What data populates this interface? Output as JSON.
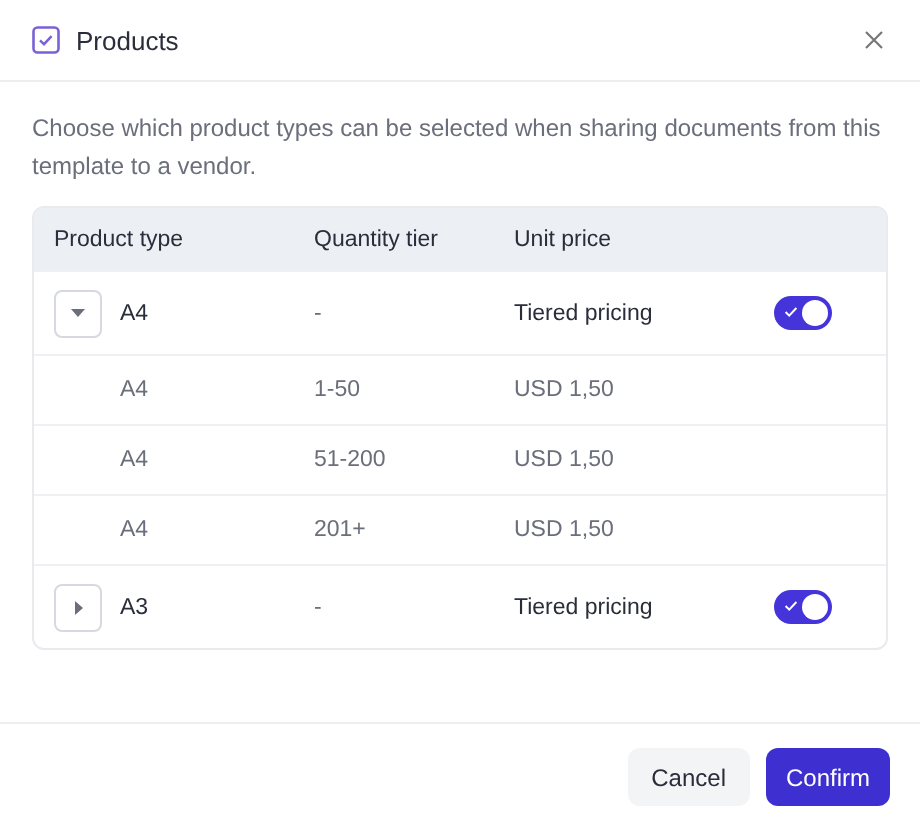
{
  "dialog": {
    "title": "Products",
    "description": "Choose which product types can be selected when sharing documents from this template to a vendor."
  },
  "table": {
    "columns": [
      "Product type",
      "Quantity tier",
      "Unit price"
    ],
    "rows": [
      {
        "kind": "group",
        "product": "A4",
        "tier": "-",
        "price": "Tiered pricing",
        "expanded": true,
        "on": true
      },
      {
        "kind": "tier",
        "product": "A4",
        "tier": "1-50",
        "price": "USD 1,50"
      },
      {
        "kind": "tier",
        "product": "A4",
        "tier": "51-200",
        "price": "USD 1,50"
      },
      {
        "kind": "tier",
        "product": "A4",
        "tier": "201+",
        "price": "USD 1,50"
      },
      {
        "kind": "group",
        "product": "A3",
        "tier": "-",
        "price": "Tiered pricing",
        "expanded": false,
        "on": true
      }
    ]
  },
  "buttons": [
    "Cancel",
    "Confirm"
  ]
}
